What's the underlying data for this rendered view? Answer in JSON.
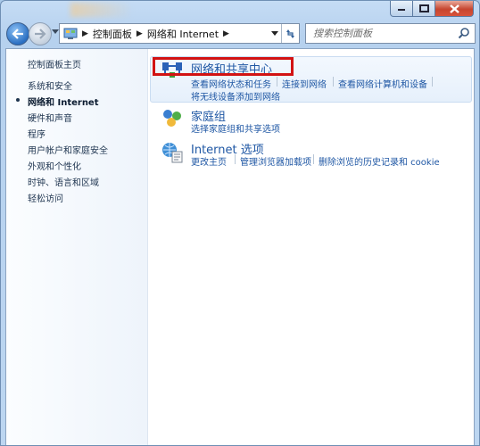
{
  "window": {
    "caption_icons": [
      "minimize-icon",
      "maximize-icon",
      "close-icon"
    ]
  },
  "navbar": {
    "back_icon": "back-arrow-icon",
    "forward_icon": "forward-arrow-icon",
    "breadcrumbs": [
      "控制面板",
      "网络和 Internet"
    ],
    "refresh_icon": "refresh-icon"
  },
  "search": {
    "placeholder": "搜索控制面板",
    "icon": "search-icon"
  },
  "sidebar": {
    "items": [
      {
        "label": "控制面板主页"
      },
      {
        "label": "系统和安全"
      },
      {
        "label": "网络和 Internet",
        "current": true
      },
      {
        "label": "硬件和声音"
      },
      {
        "label": "程序"
      },
      {
        "label": "用户帐户和家庭安全"
      },
      {
        "label": "外观和个性化"
      },
      {
        "label": "时钟、语言和区域"
      },
      {
        "label": "轻松访问"
      }
    ]
  },
  "categories": [
    {
      "title": "网络和共享中心",
      "icon": "network-sharing-center-icon",
      "links": [
        "查看网络状态和任务",
        "连接到网络",
        "查看网络计算机和设备",
        "将无线设备添加到网络"
      ]
    },
    {
      "title": "家庭组",
      "icon": "homegroup-icon",
      "links": [
        "选择家庭组和共享选项"
      ]
    },
    {
      "title": "Internet 选项",
      "icon": "internet-options-icon",
      "links": [
        "更改主页",
        "管理浏览器加载项",
        "删除浏览的历史记录和 cookie"
      ]
    }
  ],
  "colors": {
    "link": "#1f57a4",
    "highlight_box": "#d21313"
  }
}
